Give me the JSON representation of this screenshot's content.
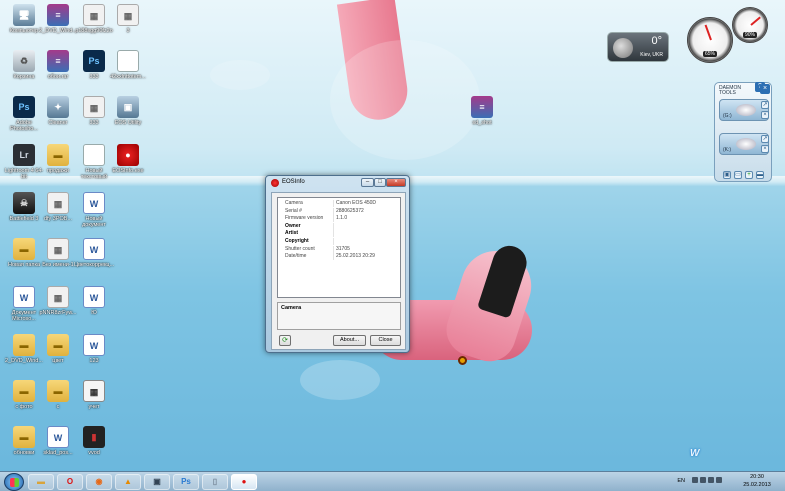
{
  "desktop_icons": [
    {
      "label": "Компьютер",
      "glyph": "🖥",
      "icon": "computer-icon"
    },
    {
      "label": "2_DVD_Wind...",
      "glyph": "≡",
      "icon": "winrar-icon"
    },
    {
      "label": "p188sgg90fz2o",
      "glyph": "▦",
      "icon": "image-icon"
    },
    {
      "label": "3",
      "glyph": "▦",
      "icon": "image-icon"
    },
    {
      "label": "Корзина",
      "glyph": "♻",
      "icon": "trash-icon"
    },
    {
      "label": "обои.rar",
      "glyph": "≡",
      "icon": "winrar-icon"
    },
    {
      "label": "333",
      "glyph": "Ps",
      "icon": "psd-file-icon"
    },
    {
      "label": "42xxlnttotem...",
      "glyph": "",
      "icon": "document-icon"
    },
    {
      "label": "Adobe Photosho...",
      "glyph": "Ps",
      "icon": "photoshop-icon"
    },
    {
      "label": "Cleaner",
      "glyph": "✦",
      "icon": "cleaner-icon"
    },
    {
      "label": "333",
      "glyph": "▦",
      "icon": "image-icon"
    },
    {
      "label": "EOS Utility",
      "glyph": "▣",
      "icon": "eos-utility-icon"
    },
    {
      "label": "Lightroom 4 64-bit",
      "glyph": "Lr",
      "icon": "lightroom-icon"
    },
    {
      "label": "продажи",
      "glyph": "▬",
      "icon": "folder-icon"
    },
    {
      "label": "Новый текстовый",
      "glyph": "",
      "icon": "text-file-icon"
    },
    {
      "label": "EOSInfo.exe",
      "glyph": "●",
      "icon": "eosinfo-icon"
    },
    {
      "label": "Battlefield 3",
      "glyph": "☠",
      "icon": "game-icon"
    },
    {
      "label": "dfy 3POB...",
      "glyph": "▦",
      "icon": "image-icon"
    },
    {
      "label": "Новый документ",
      "glyph": "W",
      "icon": "word-icon"
    },
    {
      "label": "Новая папка",
      "glyph": "▬",
      "icon": "folder-icon"
    },
    {
      "label": "Без имени-1",
      "glyph": "▦",
      "icon": "image-icon"
    },
    {
      "label": "Цветокоррекц...",
      "glyph": "W",
      "icon": "word-icon"
    },
    {
      "label": "Документ Microso...",
      "glyph": "W",
      "icon": "word-icon"
    },
    {
      "label": "pNNR8zrFyw...",
      "glyph": "▦",
      "icon": "image-icon"
    },
    {
      "label": "Ю",
      "glyph": "W",
      "icon": "word-icon"
    },
    {
      "label": "2_DVD_Wind...",
      "glyph": "▬",
      "icon": "folder-icon"
    },
    {
      "label": "цвет",
      "glyph": "▬",
      "icon": "folder-icon"
    },
    {
      "label": "123",
      "glyph": "W",
      "icon": "word-icon"
    },
    {
      "label": "с фото",
      "glyph": "▬",
      "icon": "folder-icon"
    },
    {
      "label": "с",
      "glyph": "▬",
      "icon": "folder-icon"
    },
    {
      "label": "учет",
      "glyph": "▦",
      "icon": "calculator-icon"
    },
    {
      "label": "обновки",
      "glyph": "▬",
      "icon": "folder-icon"
    },
    {
      "label": "sklad_pos...",
      "glyph": "W",
      "icon": "word-icon"
    },
    {
      "label": "vvod",
      "glyph": "▮",
      "icon": "book-icon"
    },
    {
      "label": "sd_shot",
      "glyph": "≡",
      "icon": "winrar-icon"
    }
  ],
  "weather": {
    "temp": "0°",
    "city": "Kiev, UKR"
  },
  "gauges": {
    "cpu": "90%",
    "ram": "65%"
  },
  "daemon": {
    "title": "DAEMON",
    "subtitle": "TOOLS",
    "help": "?",
    "drives": [
      "(G:)",
      "(K:)"
    ]
  },
  "window": {
    "title": "EOSInfo",
    "rows": [
      {
        "key": "Camera",
        "value": "Canon EOS 450D",
        "bold": false
      },
      {
        "key": "Serial #",
        "value": "2880625372",
        "bold": false
      },
      {
        "key": "Firmware version",
        "value": "1.1.0",
        "bold": false
      },
      {
        "key": "Owner",
        "value": "",
        "bold": true
      },
      {
        "key": "Artist",
        "value": "",
        "bold": true
      },
      {
        "key": "Copyright",
        "value": "",
        "bold": true
      },
      {
        "key": "Shutter count",
        "value": "31705",
        "bold": false
      },
      {
        "key": "Date/time",
        "value": "25.02.2013 20:29",
        "bold": false
      }
    ],
    "description": "Camera",
    "about_label": "About...",
    "close_label": "Close"
  },
  "taskbar": {
    "items": [
      {
        "glyph": "▬",
        "icon": "explorer-icon",
        "color": "#d9a43a"
      },
      {
        "glyph": "O",
        "icon": "opera-icon",
        "color": "#d11"
      },
      {
        "glyph": "◉",
        "icon": "firefox-icon",
        "color": "#e66a1a"
      },
      {
        "glyph": "▲",
        "icon": "vlc-icon",
        "color": "#e68a00"
      },
      {
        "glyph": "▣",
        "icon": "utility-icon",
        "color": "#345"
      },
      {
        "glyph": "Ps",
        "icon": "photoshop-icon",
        "color": "#2a7ad1"
      },
      {
        "glyph": "▯",
        "icon": "document-icon",
        "color": "#789"
      },
      {
        "glyph": "●",
        "icon": "eosinfo-icon",
        "color": "#d11"
      }
    ],
    "lang": "EN",
    "time": "20:30",
    "date": "25.02.2013"
  }
}
